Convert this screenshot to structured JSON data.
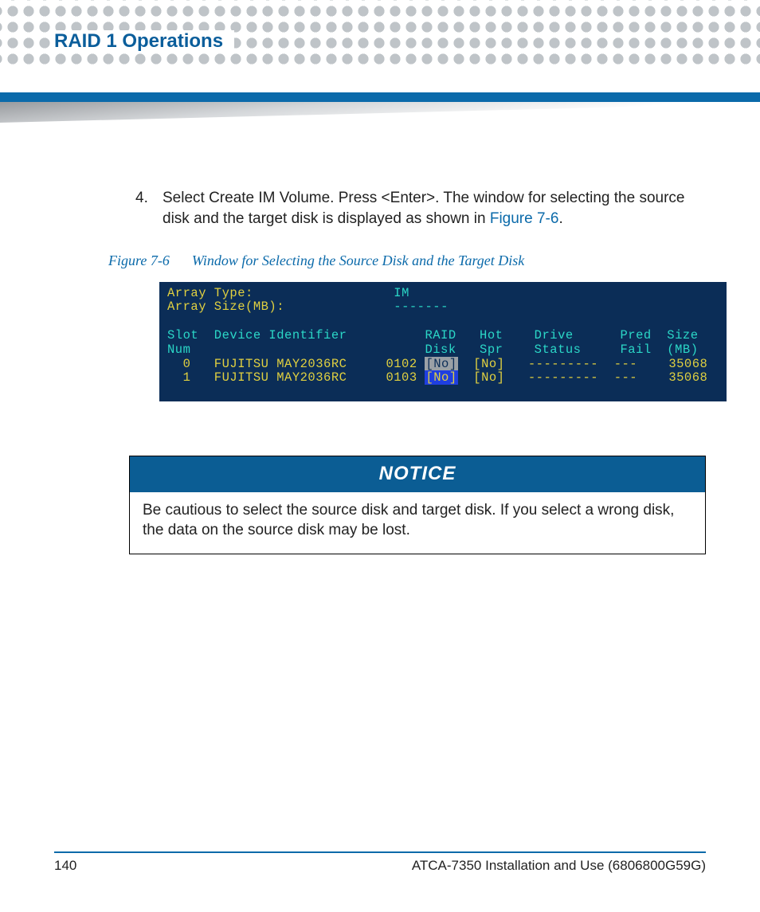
{
  "heading": "RAID 1 Operations",
  "step": {
    "number": "4.",
    "text_before_link": "Select Create IM Volume. Press <Enter>. The window for selecting the source disk and the target disk is displayed as shown in ",
    "link_text": "Figure 7-6",
    "text_after_link": "."
  },
  "figure": {
    "label": "Figure 7-6",
    "title": "Window for Selecting the Source Disk and the Target Disk"
  },
  "terminal": {
    "line1_label": "Array Type:",
    "line1_value": "IM",
    "line2_label": "Array Size(MB):",
    "line2_value": "-------",
    "hdr_a": "Slot  Device Identifier          RAID   Hot    Drive      Pred  Size",
    "hdr_b": "Num                              Disk   Spr    Status     Fail  (MB)",
    "row0_pre": "  0   FUJITSU MAY2036RC     0102 ",
    "row0_hl": "[No]",
    "row0_post": "  [No]   ---------  ---    35068",
    "row1_pre": "  1   FUJITSU MAY2036RC     0103 ",
    "row1_hl": "[No]",
    "row1_post": "  [No]   ---------  ---    35068"
  },
  "notice": {
    "title": "NOTICE",
    "body": "Be cautious to select the source disk and target disk. If you select a wrong disk, the data on the source disk may be lost."
  },
  "footer": {
    "page_number": "140",
    "doc_title": "ATCA-7350 Installation and Use (6806800G59G)"
  }
}
